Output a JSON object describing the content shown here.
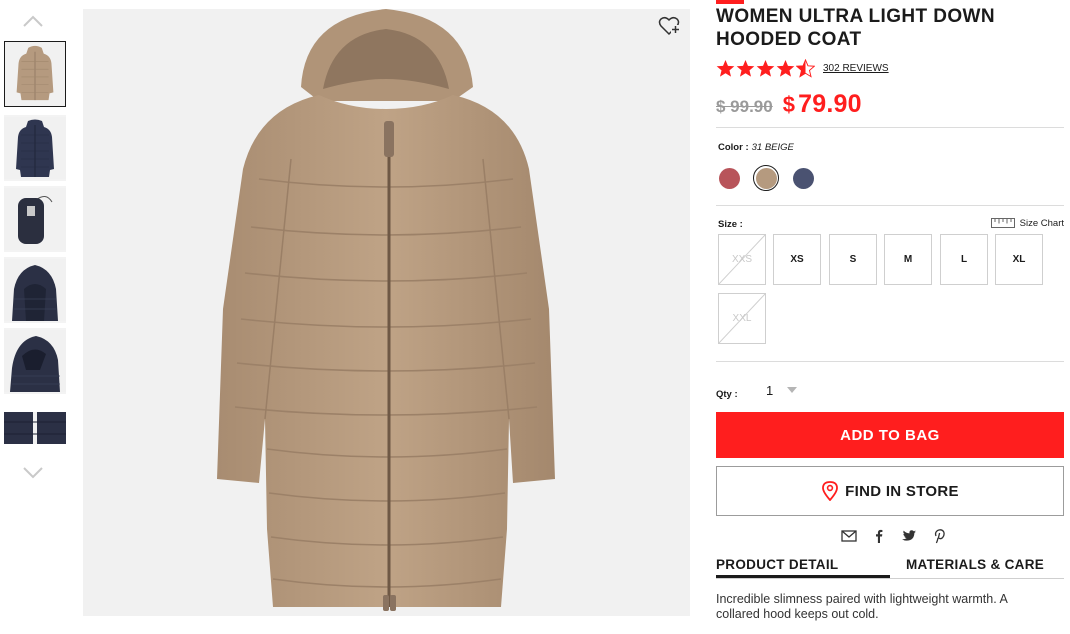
{
  "product": {
    "title": "WOMEN ULTRA LIGHT DOWN HOODED COAT",
    "rating": 4.5,
    "reviews_label": "302 REVIEWS",
    "original_price": "$ 99.90",
    "sale_currency": "$",
    "sale_amount": "79.90",
    "accent_color": "#ff1e1e"
  },
  "color": {
    "label": "Color :",
    "selected": "31 BEIGE",
    "swatches": [
      {
        "name": "red",
        "hex": "#b8545a"
      },
      {
        "name": "beige",
        "hex": "#b59a7f",
        "selected": true
      },
      {
        "name": "navy",
        "hex": "#4a5271"
      }
    ]
  },
  "size": {
    "label": "Size :",
    "chart_label": "Size Chart",
    "options": [
      {
        "label": "XXS",
        "available": false
      },
      {
        "label": "XS",
        "available": true
      },
      {
        "label": "S",
        "available": true
      },
      {
        "label": "M",
        "available": true
      },
      {
        "label": "L",
        "available": true
      },
      {
        "label": "XL",
        "available": true
      },
      {
        "label": "XXL",
        "available": false
      }
    ]
  },
  "qty": {
    "label": "Qty :",
    "value": "1"
  },
  "buttons": {
    "add_to_bag": "ADD TO BAG",
    "find_in_store": "FIND IN STORE"
  },
  "share_icons": [
    "mail-icon",
    "facebook-icon",
    "twitter-icon",
    "pinterest-icon"
  ],
  "tabs": {
    "detail": "PRODUCT DETAIL",
    "materials": "MATERIALS & CARE"
  },
  "description": "Incredible slimness paired with lightweight warmth. A collared hood keeps out cold.",
  "thumbnails": [
    "beige-coat-front",
    "navy-coat-front",
    "pouch",
    "navy-hood-closeup",
    "navy-hood-side",
    "navy-fabric-detail"
  ]
}
